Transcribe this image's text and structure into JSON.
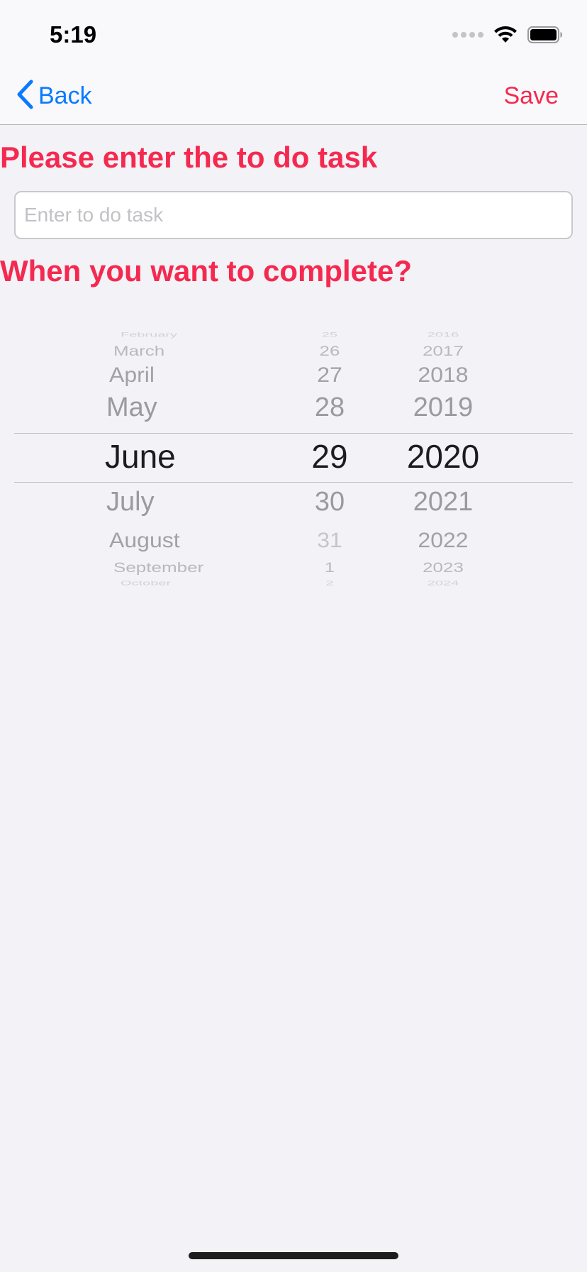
{
  "status_bar": {
    "time": "5:19",
    "signal_icon": "cellular-signal-icon",
    "wifi_icon": "wifi-icon",
    "battery_icon": "battery-icon"
  },
  "nav": {
    "back_icon": "chevron-left-icon",
    "back_label": "Back",
    "save_label": "Save"
  },
  "form": {
    "task_heading": "Please enter the to do task",
    "task_input_value": "",
    "task_input_placeholder": "Enter to do task",
    "date_heading": "When you want to complete?"
  },
  "date_picker": {
    "months": [
      "February",
      "March",
      "April",
      "May",
      "June",
      "July",
      "August",
      "September",
      "October"
    ],
    "days": [
      "25",
      "26",
      "27",
      "28",
      "29",
      "30",
      "31",
      "1",
      "2"
    ],
    "years": [
      "2016",
      "2017",
      "2018",
      "2019",
      "2020",
      "2021",
      "2022",
      "2023",
      "2024"
    ],
    "selected": {
      "month": "June",
      "day": "29",
      "year": "2020"
    }
  },
  "colors": {
    "accent_red": "#f5294f",
    "link_blue": "#0a7aff",
    "background": "#f2f2f7"
  }
}
